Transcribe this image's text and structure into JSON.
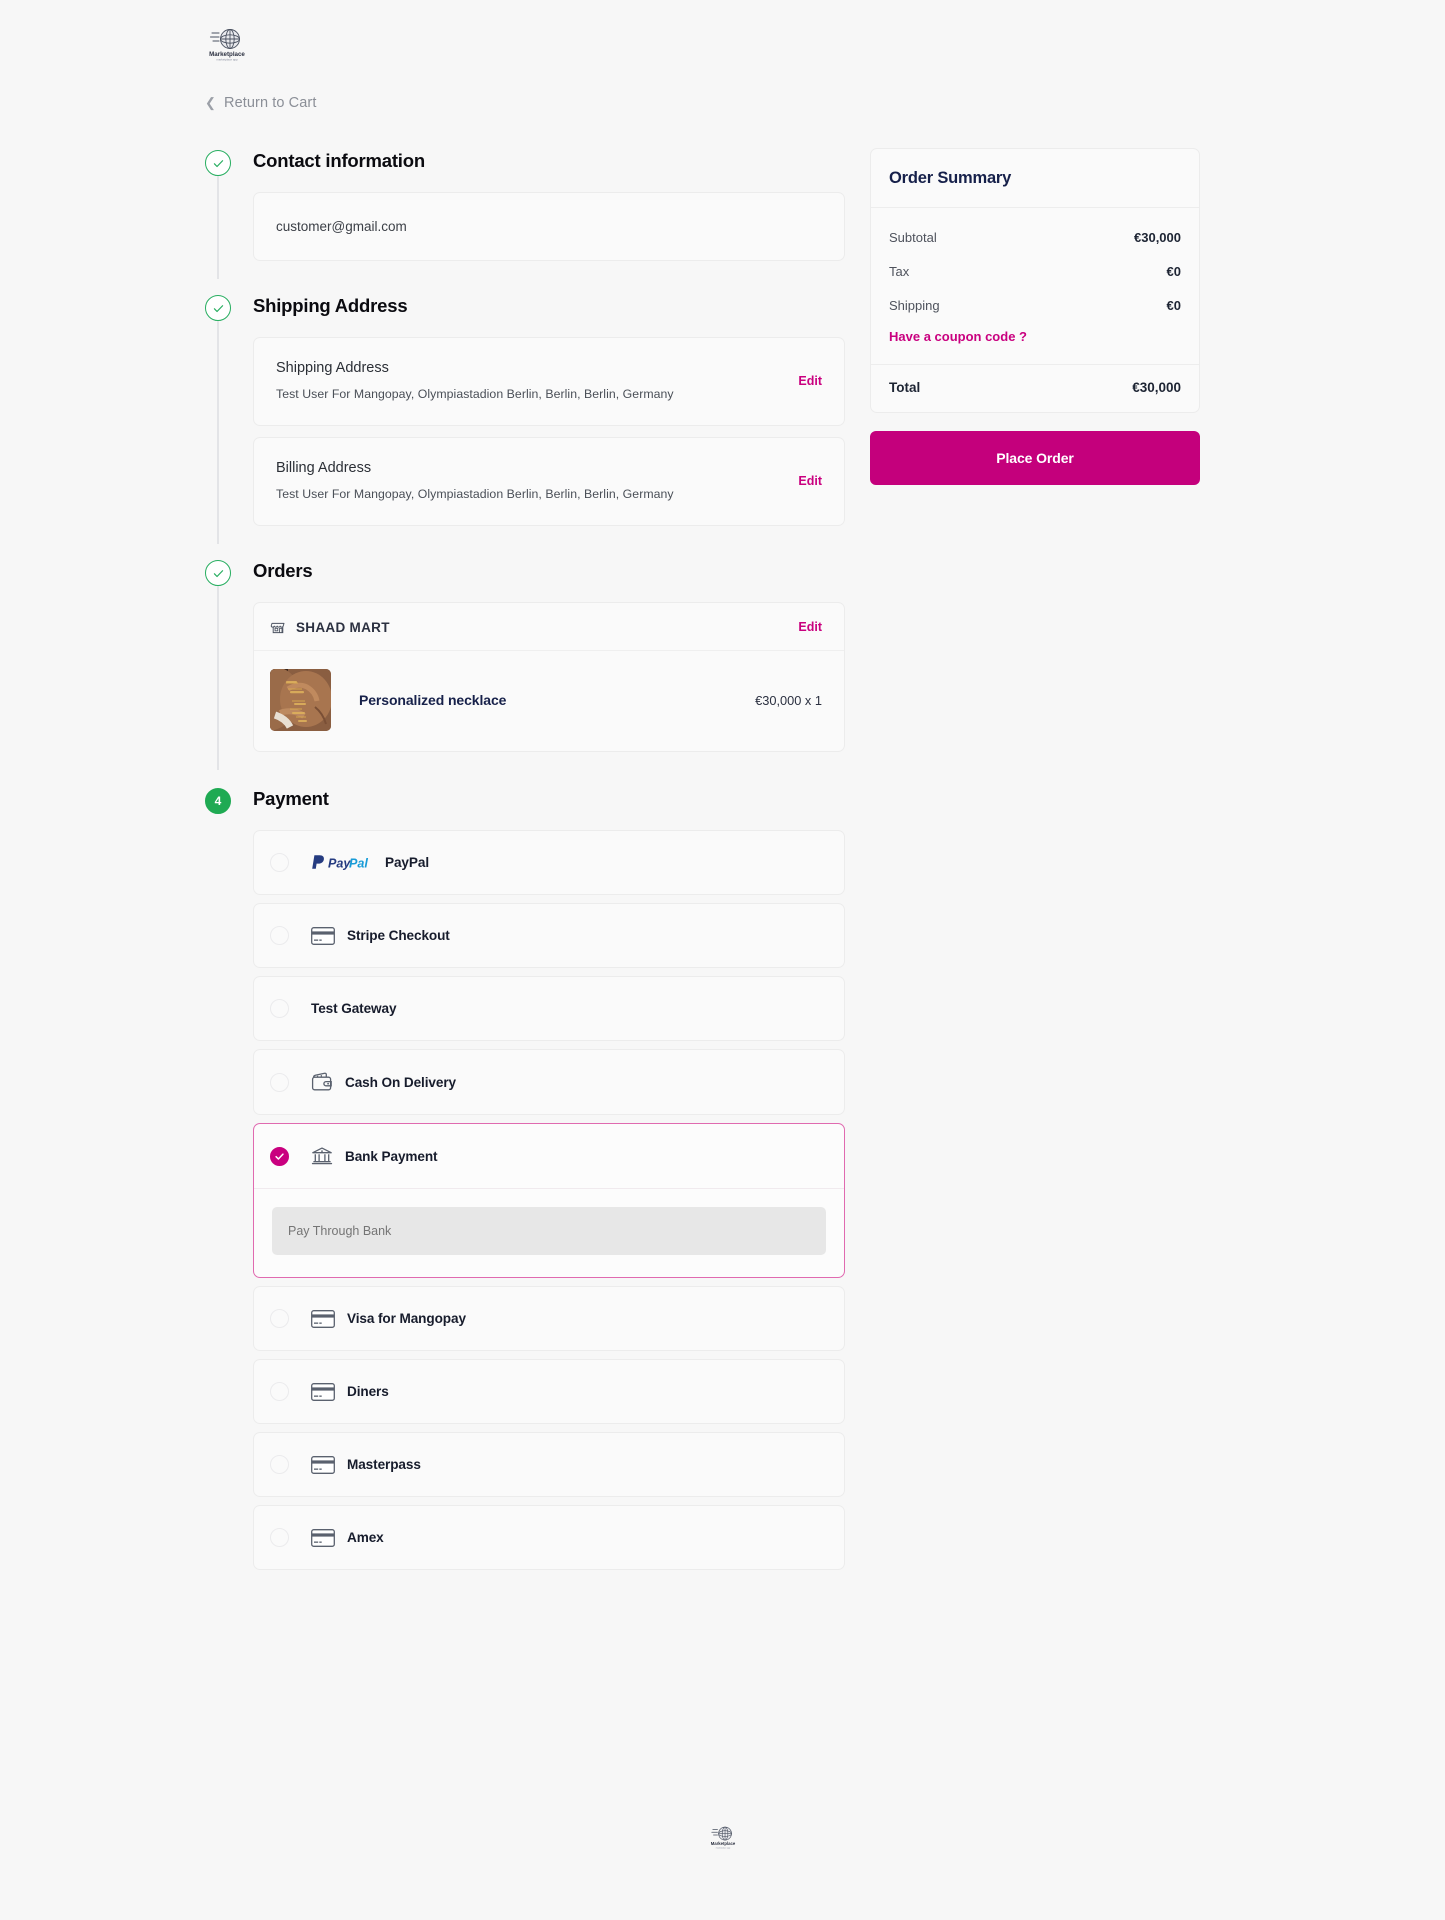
{
  "brand": {
    "name": "Marketplace",
    "accent": "#c9007f",
    "green": "#1faa53",
    "logo_icon": "globe-marketplace-logo"
  },
  "header": {
    "logo_alt": "Marketplace"
  },
  "nav": {
    "return_label": "Return to Cart",
    "back_icon": "chevron-left-icon"
  },
  "steps": [
    {
      "id": "contact",
      "state": "done",
      "badge": "check-icon",
      "title": "Contact information"
    },
    {
      "id": "shipping",
      "state": "done",
      "badge": "check-icon",
      "title": "Shipping Address"
    },
    {
      "id": "orders",
      "state": "done",
      "badge": "check-icon",
      "title": "Orders"
    },
    {
      "id": "payment",
      "state": "active",
      "badge": "4",
      "title": "Payment"
    }
  ],
  "contact": {
    "email": "customer@gmail.com"
  },
  "addresses": [
    {
      "label": "Shipping Address",
      "value": "Test User For Mangopay, Olympiastadion Berlin, Berlin, Berlin, Germany",
      "edit_label": "Edit"
    },
    {
      "label": "Billing Address",
      "value": "Test User For Mangopay, Olympiastadion Berlin, Berlin, Berlin, Germany",
      "edit_label": "Edit"
    }
  ],
  "orders": {
    "store_name": "SHAAD MART",
    "store_icon": "store-icon",
    "edit_label": "Edit",
    "items": [
      {
        "name": "Personalized necklace",
        "price": "€30,000 x 1",
        "thumb_alt": "personalized-necklace-photo"
      }
    ]
  },
  "payment": {
    "selected_id": "bank-payment",
    "methods": [
      {
        "id": "paypal",
        "label": "PayPal",
        "icon": "paypal-logo",
        "selected": false
      },
      {
        "id": "stripe-checkout",
        "label": "Stripe Checkout",
        "icon": "credit-card-icon",
        "selected": false
      },
      {
        "id": "test-gateway",
        "label": "Test Gateway",
        "icon": "none",
        "selected": false
      },
      {
        "id": "cash-on-delivery",
        "label": "Cash On Delivery",
        "icon": "wallet-icon",
        "selected": false
      },
      {
        "id": "bank-payment",
        "label": "Bank Payment",
        "icon": "bank-icon",
        "selected": true
      },
      {
        "id": "visa-for-mangopay",
        "label": "Visa for Mangopay",
        "icon": "credit-card-icon",
        "selected": false
      },
      {
        "id": "diners",
        "label": "Diners",
        "icon": "credit-card-icon",
        "selected": false
      },
      {
        "id": "masterpass",
        "label": "Masterpass",
        "icon": "credit-card-icon",
        "selected": false
      },
      {
        "id": "amex",
        "label": "Amex",
        "icon": "credit-card-icon",
        "selected": false
      }
    ],
    "bank": {
      "field_value": "Pay Through Bank",
      "field_placeholder": "Pay Through Bank"
    }
  },
  "summary": {
    "title": "Order Summary",
    "rows": [
      {
        "key": "Subtotal",
        "value": "€30,000"
      },
      {
        "key": "Tax",
        "value": "€0"
      },
      {
        "key": "Shipping",
        "value": "€0"
      }
    ],
    "coupon_label": "Have a coupon code ?",
    "total_key": "Total",
    "total_value": "€30,000",
    "place_order_label": "Place Order"
  },
  "footer": {
    "logo_alt": "Marketplace"
  }
}
